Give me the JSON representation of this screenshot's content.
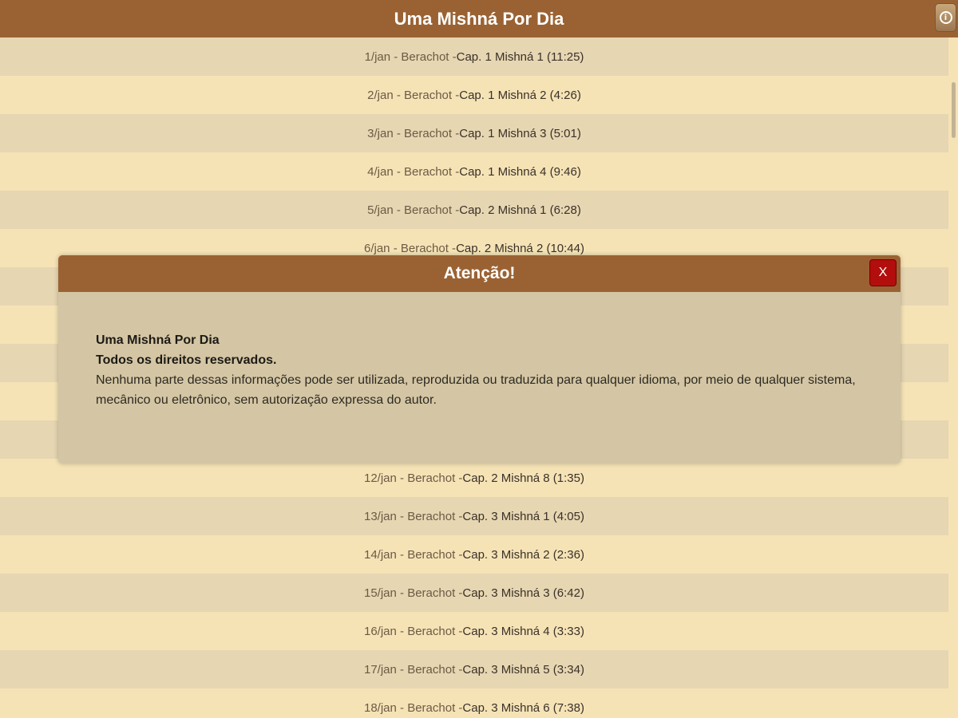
{
  "header": {
    "title": "Uma Mishná Por Dia",
    "button_icon": "info-icon"
  },
  "list": {
    "rows": [
      {
        "prefix": "1/jan - Berachot - ",
        "cap": "Cap. 1 Mishná 1 (11:25)"
      },
      {
        "prefix": "2/jan - Berachot - ",
        "cap": "Cap. 1 Mishná 2 (4:26)"
      },
      {
        "prefix": "3/jan - Berachot - ",
        "cap": "Cap. 1 Mishná 3 (5:01)"
      },
      {
        "prefix": "4/jan - Berachot - ",
        "cap": "Cap. 1 Mishná 4 (9:46)"
      },
      {
        "prefix": "5/jan - Berachot - ",
        "cap": "Cap. 2 Mishná 1 (6:28)"
      },
      {
        "prefix": "6/jan - Berachot - ",
        "cap": "Cap. 2 Mishná 2 (10:44)"
      },
      {
        "prefix": "",
        "cap": ""
      },
      {
        "prefix": "",
        "cap": ""
      },
      {
        "prefix": "",
        "cap": ""
      },
      {
        "prefix": "",
        "cap": ""
      },
      {
        "prefix": "",
        "cap": ""
      },
      {
        "prefix": "12/jan - Berachot - ",
        "cap": "Cap. 2 Mishná 8 (1:35)"
      },
      {
        "prefix": "13/jan - Berachot - ",
        "cap": "Cap. 3 Mishná 1 (4:05)"
      },
      {
        "prefix": "14/jan - Berachot - ",
        "cap": "Cap. 3 Mishná 2 (2:36)"
      },
      {
        "prefix": "15/jan - Berachot - ",
        "cap": "Cap. 3 Mishná 3 (6:42)"
      },
      {
        "prefix": "16/jan - Berachot - ",
        "cap": "Cap. 3 Mishná 4 (3:33)"
      },
      {
        "prefix": "17/jan - Berachot - ",
        "cap": "Cap. 3 Mishná 5 (3:34)"
      },
      {
        "prefix": "18/jan - Berachot - ",
        "cap": "Cap. 3 Mishná 6 (7:38)"
      }
    ]
  },
  "dialog": {
    "title": "Atenção!",
    "close_label": "X",
    "line1": "Uma Mishná Por Dia",
    "line2": "Todos os direitos reservados.",
    "body": "Nenhuma parte dessas informações pode ser utilizada, reproduzida ou traduzida para qualquer idioma, por meio de qualquer sistema, mecânico ou eletrônico, sem autorização expressa do autor."
  },
  "colors": {
    "brand": "#9a6233",
    "row_light": "#f5e3b6",
    "row_dark": "#e6d6b2",
    "dialog_bg": "#d4c6a4",
    "close": "#b20e0e"
  }
}
